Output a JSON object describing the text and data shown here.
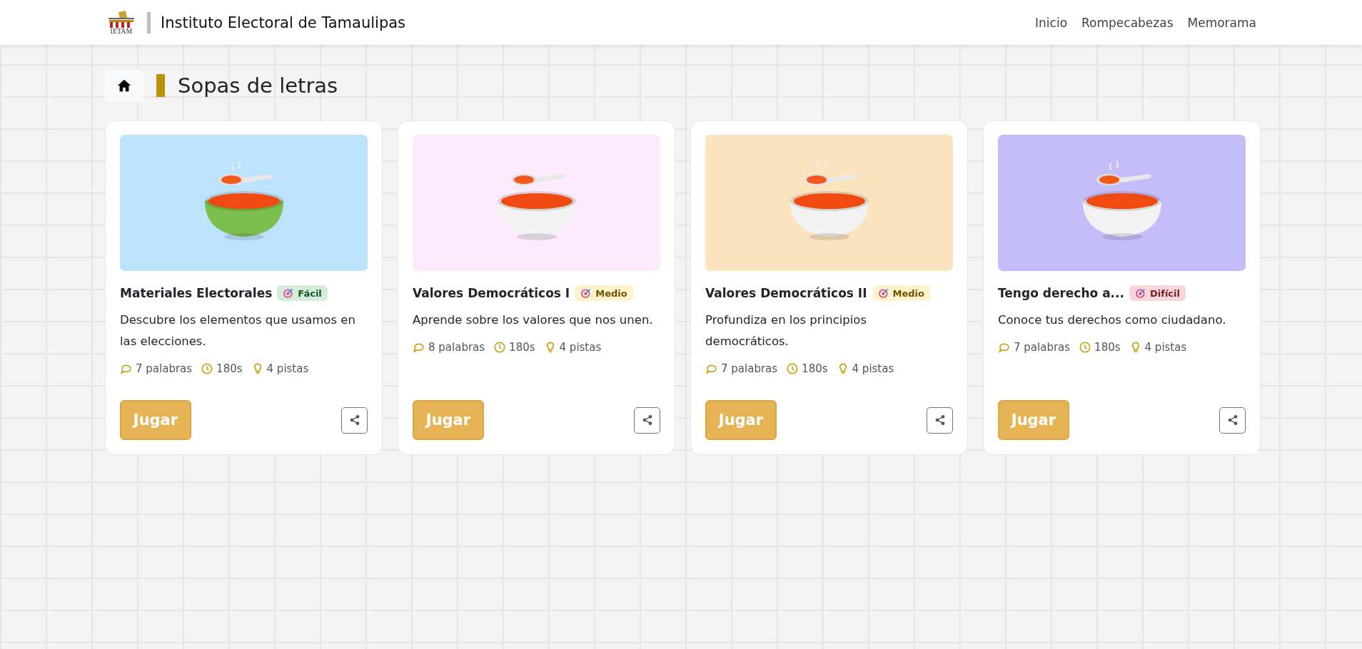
{
  "header": {
    "logo_text": "IETAM",
    "title": "Instituto Electoral de Tamaulipas",
    "nav": [
      {
        "label": "Inicio"
      },
      {
        "label": "Rompecabezas"
      },
      {
        "label": "Memorama"
      }
    ]
  },
  "page_title": "Sopas de letras",
  "cards": [
    {
      "title": "Materiales Electorales",
      "difficulty": {
        "kind": "easy",
        "label": "Fácil"
      },
      "color": "#bde3fa",
      "bowl": {
        "color": "#7cbf4f"
      },
      "description": "Descubre los elementos que usamos en las elecciones.",
      "words": "7 palabras",
      "time": "180s",
      "hints": "4 pistas",
      "button": "Jugar"
    },
    {
      "title": "Valores Democráticos I",
      "difficulty": {
        "kind": "medium",
        "label": "Medio"
      },
      "color": "#fdeafc",
      "bowl": {
        "color": "#f2f2f2"
      },
      "description": "Aprende sobre los valores que nos unen.",
      "words": "8 palabras",
      "time": "180s",
      "hints": "4 pistas",
      "button": "Jugar"
    },
    {
      "title": "Valores Democráticos II",
      "difficulty": {
        "kind": "medium",
        "label": "Medio"
      },
      "color": "#fbe3bd",
      "bowl": {
        "color": "#f2f2f2"
      },
      "description": "Profundiza en los principios democráticos.",
      "words": "7 palabras",
      "time": "180s",
      "hints": "4 pistas",
      "button": "Jugar"
    },
    {
      "title": "Tengo derecho a...",
      "difficulty": {
        "kind": "hard",
        "label": "Difícil"
      },
      "color": "#c5bcfa",
      "bowl": {
        "color": "#f2f2f2"
      },
      "description": "Conoce tus derechos como ciudadano.",
      "words": "7 palabras",
      "time": "180s",
      "hints": "4 pistas",
      "button": "Jugar"
    }
  ]
}
